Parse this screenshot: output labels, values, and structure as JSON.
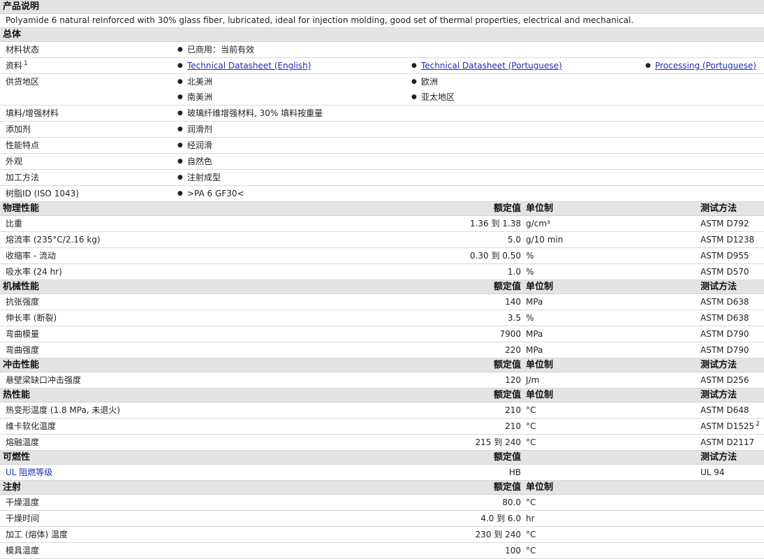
{
  "description": {
    "header": "产品说明",
    "text": "Polyamide 6 natural reinforced with 30% glass fiber, lubricated, ideal for injection molding, good set of thermal properties, electrical and mechanical."
  },
  "general": {
    "header": "总体",
    "material_status_label": "材料状态",
    "material_status": "已商用：当前有效",
    "docs_label": "资料",
    "docs_sup": "1",
    "docs": [
      "Technical Datasheet (English)",
      "Technical Datasheet (Portuguese)",
      "Processing (Portuguese)"
    ],
    "regions_label": "供货地区",
    "regions": [
      "北美洲",
      "欧洲",
      "南美洲",
      "亚太地区"
    ],
    "filler_label": "填料/增强材料",
    "filler": "玻璃纤维增强材料, 30% 填料按重量",
    "additive_label": "添加剂",
    "additive": "润滑剂",
    "features_label": "性能特点",
    "features": "经润滑",
    "appearance_label": "外观",
    "appearance": "自然色",
    "processing_label": "加工方法",
    "processing": "注射成型",
    "resin_id_label": "树脂ID (ISO 1043)",
    "resin_id": ">PA 6 GF30<"
  },
  "cols": {
    "nominal": "额定值",
    "unit": "单位制",
    "test": "测试方法"
  },
  "sections": [
    {
      "title": "物理性能",
      "show_unit": true,
      "show_test": true,
      "rows": [
        {
          "label": "比重",
          "value": "1.36 到  1.38",
          "unit": "g/cm³",
          "test": "ASTM D792"
        },
        {
          "label": "熔流率 (235°C/2.16 kg)",
          "value": "5.0",
          "unit": "g/10 min",
          "test": "ASTM D1238"
        },
        {
          "label": "收缩率  - 流动",
          "value": "0.30 到  0.50",
          "unit": "%",
          "test": "ASTM D955"
        },
        {
          "label": "吸水率 (24 hr)",
          "value": "1.0",
          "unit": "%",
          "test": "ASTM D570"
        }
      ]
    },
    {
      "title": "机械性能",
      "show_unit": true,
      "show_test": true,
      "rows": [
        {
          "label": "抗张强度",
          "value": "140",
          "unit": "MPa",
          "test": "ASTM D638"
        },
        {
          "label": "伸长率 (断裂)",
          "value": "3.5",
          "unit": "%",
          "test": "ASTM D638"
        },
        {
          "label": "弯曲模量",
          "value": "7900",
          "unit": "MPa",
          "test": "ASTM D790"
        },
        {
          "label": "弯曲强度",
          "value": "220",
          "unit": "MPa",
          "test": "ASTM D790"
        }
      ]
    },
    {
      "title": "冲击性能",
      "show_unit": true,
      "show_test": true,
      "rows": [
        {
          "label": "悬壁梁缺口冲击强度",
          "value": "120",
          "unit": "J/m",
          "test": "ASTM D256"
        }
      ]
    },
    {
      "title": "热性能",
      "show_unit": true,
      "show_test": true,
      "rows": [
        {
          "label": "热变形温度 (1.8 MPa, 未退火)",
          "value": "210",
          "unit": "°C",
          "test": "ASTM D648"
        },
        {
          "label": "维卡软化温度",
          "value": "210",
          "unit": "°C",
          "test": "ASTM D1525",
          "test_sup": "2"
        },
        {
          "label": "熔融温度",
          "value": "215 到  240",
          "unit": "°C",
          "test": "ASTM D2117"
        }
      ]
    },
    {
      "title": "可燃性",
      "show_unit": false,
      "show_test": true,
      "rows": [
        {
          "label": "UL 阻燃等级",
          "value": "HB",
          "unit": "",
          "test": "UL 94",
          "blue": true
        }
      ]
    },
    {
      "title": "注射",
      "show_unit": true,
      "show_test": false,
      "rows": [
        {
          "label": "干燥温度",
          "value": "80.0",
          "unit": "°C",
          "test": ""
        },
        {
          "label": "干燥时间",
          "value": "4.0 到  6.0",
          "unit": "hr",
          "test": ""
        },
        {
          "label": "加工 (熔体) 温度",
          "value": "230 到  240",
          "unit": "°C",
          "test": ""
        },
        {
          "label": "模具温度",
          "value": "100",
          "unit": "°C",
          "test": ""
        }
      ]
    }
  ]
}
